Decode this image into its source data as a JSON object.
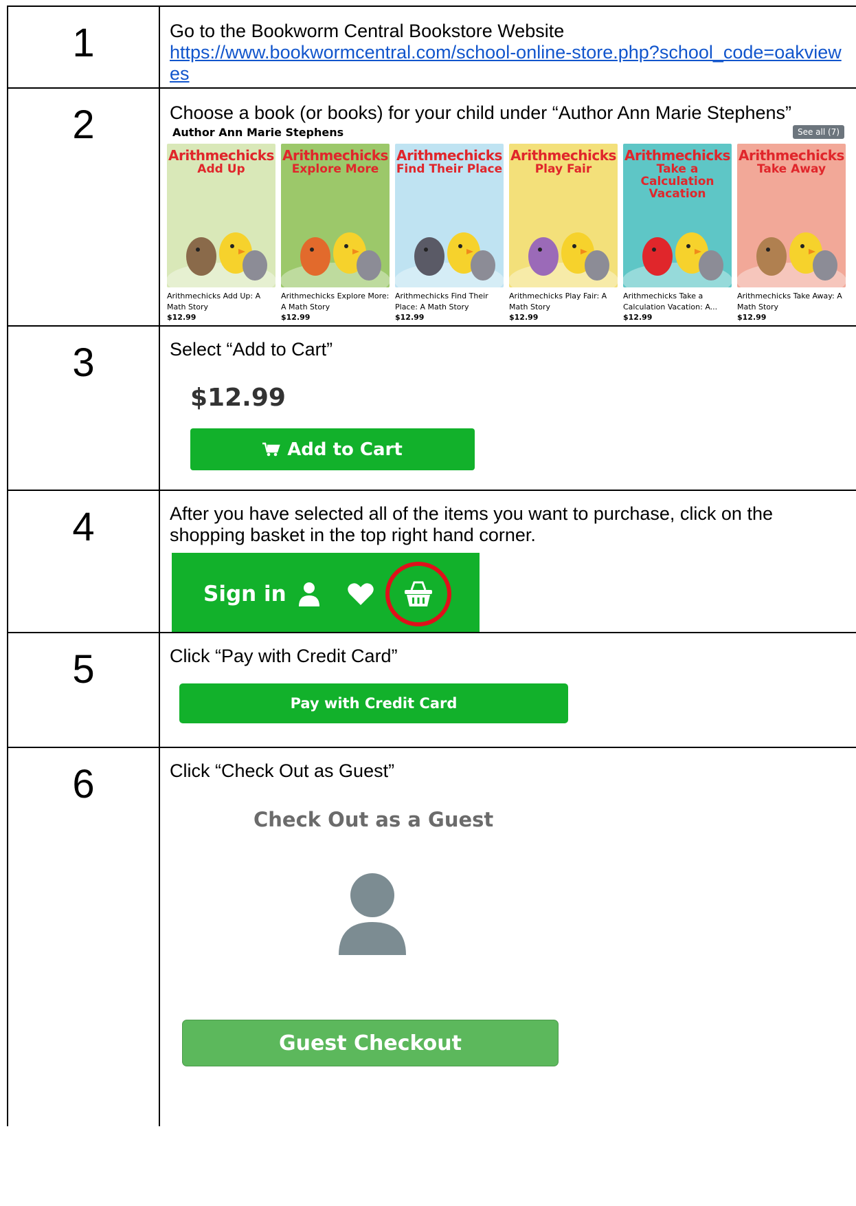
{
  "steps": [
    {
      "number": "1",
      "text": "Go to the Bookworm Central Bookstore Website",
      "link": "https://www.bookwormcentral.com/school-online-store.php?school_code=oakviewes"
    },
    {
      "number": "2",
      "text": "Choose a book (or books) for your child under “Author Ann Marie Stephens”"
    },
    {
      "number": "3",
      "text": "Select “Add to Cart”"
    },
    {
      "number": "4",
      "text": "After you have selected all of the items you want to purchase, click on the shopping basket in the top right hand corner."
    },
    {
      "number": "5",
      "text": "Click “Pay with Credit Card”"
    },
    {
      "number": "6",
      "text": "Click “Check Out as Guest”"
    }
  ],
  "books_section": {
    "title": "Author Ann Marie Stephens",
    "see_all": "See all (7)",
    "books": [
      {
        "cover_title": "Arithmechicks",
        "cover_sub": "Add Up",
        "name": "Arithmechicks Add Up: A Math Story",
        "price": "$12.99",
        "bg": "#d9e8b8",
        "accent": "#8a6a4a"
      },
      {
        "cover_title": "Arithmechicks",
        "cover_sub": "Explore More",
        "name": "Arithmechicks Explore More: A Math Story",
        "price": "$12.99",
        "bg": "#9cc86a",
        "accent": "#e26a2c"
      },
      {
        "cover_title": "Arithmechicks",
        "cover_sub": "Find Their Place",
        "name": "Arithmechicks Find Their Place: A Math Story",
        "price": "$12.99",
        "bg": "#bfe3f2",
        "accent": "#5a5a66"
      },
      {
        "cover_title": "Arithmechicks",
        "cover_sub": "Play Fair",
        "name": "Arithmechicks Play Fair: A Math Story",
        "price": "$12.99",
        "bg": "#f3e07a",
        "accent": "#9b6ab8"
      },
      {
        "cover_title": "Arithmechicks",
        "cover_sub": "Take a Calculation Vacation",
        "name": "Arithmechicks Take a Calculation Vacation: A...",
        "price": "$12.99",
        "bg": "#5ec6c6",
        "accent": "#e0262b"
      },
      {
        "cover_title": "Arithmechicks",
        "cover_sub": "Take Away",
        "name": "Arithmechicks Take Away: A Math Story",
        "price": "$12.99",
        "bg": "#f2a898",
        "accent": "#b08050"
      }
    ]
  },
  "cart": {
    "price": "$12.99",
    "button": "Add to Cart"
  },
  "header_bar": {
    "signin": "Sign in"
  },
  "pay": {
    "button": "Pay with Credit Card"
  },
  "guest": {
    "title": "Check Out as a Guest",
    "button": "Guest Checkout"
  },
  "colors": {
    "brand_green": "#12b12b",
    "guest_green": "#5cb85c",
    "link_blue": "#1155cc",
    "highlight_red": "#e0101a"
  }
}
